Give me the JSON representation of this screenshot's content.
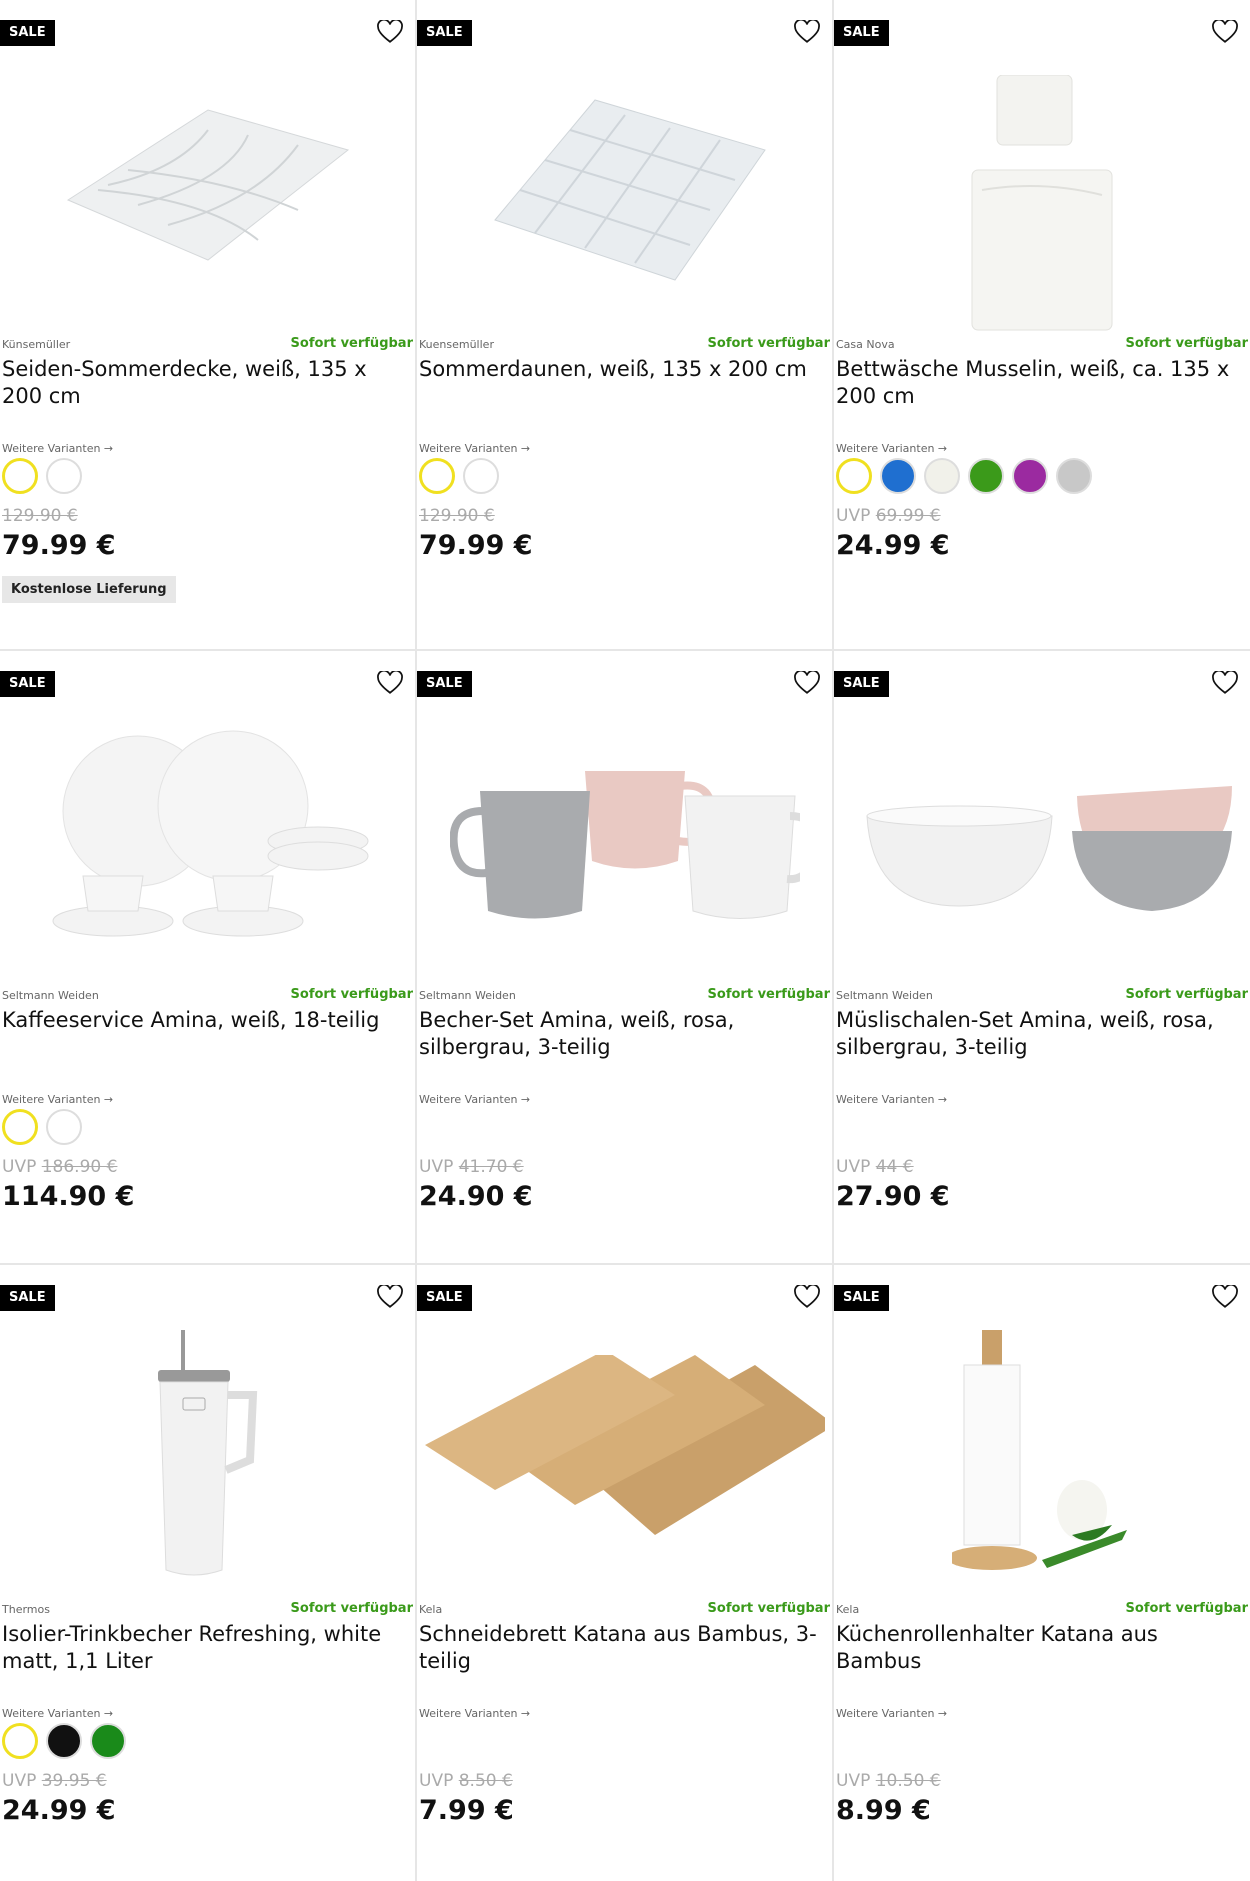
{
  "products": [
    {
      "sale": "SALE",
      "brand": "Künsemüller",
      "availability": "Sofort verfügbar",
      "title": "Seiden-Sommerdecke, weiß, 135 x 200 cm",
      "variants_link": "Weitere Varianten →",
      "swatches": [
        "#ffffff",
        "#ffffff"
      ],
      "selected_swatch": 0,
      "uvp": "",
      "old_price": "129.90 €",
      "price": "79.99 €",
      "badge": "Kostenlose Lieferung",
      "image": "duvet-quilted"
    },
    {
      "sale": "SALE",
      "brand": "Kuensemüller",
      "availability": "Sofort verfügbar",
      "title": "Sommerdaunen, weiß, 135 x 200 cm",
      "variants_link": "Weitere Varianten →",
      "swatches": [
        "#ffffff",
        "#ffffff"
      ],
      "selected_swatch": 0,
      "uvp": "",
      "old_price": "129.90 €",
      "price": "79.99 €",
      "badge": "",
      "image": "duvet-grid"
    },
    {
      "sale": "SALE",
      "brand": "Casa Nova",
      "availability": "Sofort verfügbar",
      "title": "Bettwäsche Musselin, weiß, ca. 135 x 200 cm",
      "variants_link": "Weitere Varianten →",
      "swatches": [
        "#ffffff",
        "#1f6fd0",
        "#f1f1ea",
        "#3b9a1a",
        "#9b2aa0",
        "#c8c8c8"
      ],
      "selected_swatch": 0,
      "uvp": "UVP",
      "old_price": "69.99 €",
      "price": "24.99 €",
      "badge": "",
      "image": "bedding"
    },
    {
      "sale": "SALE",
      "brand": "Seltmann Weiden",
      "availability": "Sofort verfügbar",
      "title": "Kaffeeservice Amina, weiß, 18-teilig",
      "variants_link": "Weitere Varianten →",
      "swatches": [
        "#ffffff",
        "#ffffff"
      ],
      "selected_swatch": 0,
      "uvp": "UVP",
      "old_price": "186.90 €",
      "price": "114.90 €",
      "badge": "",
      "image": "coffee-set"
    },
    {
      "sale": "SALE",
      "brand": "Seltmann Weiden",
      "availability": "Sofort verfügbar",
      "title": "Becher-Set Amina, weiß, rosa, silbergrau, 3-teilig",
      "variants_link": "Weitere Varianten →",
      "swatches": [],
      "selected_swatch": -1,
      "uvp": "UVP",
      "old_price": "41.70 €",
      "price": "24.90 €",
      "badge": "",
      "image": "mugs"
    },
    {
      "sale": "SALE",
      "brand": "Seltmann Weiden",
      "availability": "Sofort verfügbar",
      "title": "Müslischalen-Set Amina, weiß, rosa, silbergrau, 3-teilig",
      "variants_link": "Weitere Varianten →",
      "swatches": [],
      "selected_swatch": -1,
      "uvp": "UVP",
      "old_price": "44 €",
      "price": "27.90 €",
      "badge": "",
      "image": "bowls"
    },
    {
      "sale": "SALE",
      "brand": "Thermos",
      "availability": "Sofort verfügbar",
      "title": "Isolier-Trinkbecher Refreshing, white matt, 1,1 Liter",
      "variants_link": "Weitere Varianten →",
      "swatches": [
        "#ffffff",
        "#111111",
        "#1a8a1a"
      ],
      "selected_swatch": 0,
      "uvp": "UVP",
      "old_price": "39.95 €",
      "price": "24.99 €",
      "badge": "",
      "image": "tumbler"
    },
    {
      "sale": "SALE",
      "brand": "Kela",
      "availability": "Sofort verfügbar",
      "title": "Schneidebrett Katana aus Bambus, 3-teilig",
      "variants_link": "Weitere Varianten →",
      "swatches": [],
      "selected_swatch": -1,
      "uvp": "UVP",
      "old_price": "8.50 €",
      "price": "7.99 €",
      "badge": "",
      "image": "boards"
    },
    {
      "sale": "SALE",
      "brand": "Kela",
      "availability": "Sofort verfügbar",
      "title": "Küchenrollenhalter Katana aus Bambus",
      "variants_link": "Weitere Varianten →",
      "swatches": [],
      "selected_swatch": -1,
      "uvp": "UVP",
      "old_price": "10.50 €",
      "price": "8.99 €",
      "badge": "",
      "image": "paper-holder"
    }
  ]
}
